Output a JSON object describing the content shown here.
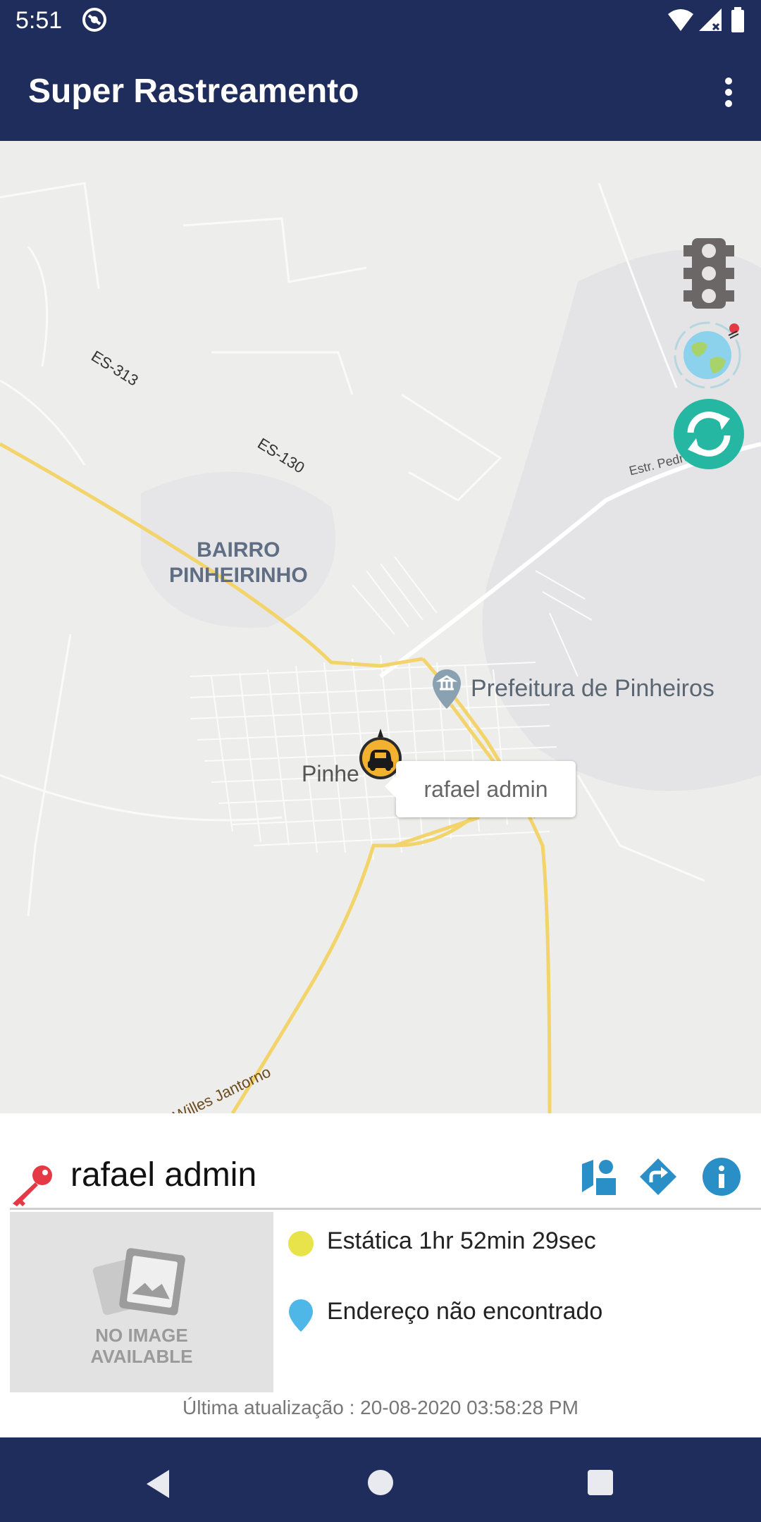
{
  "status_bar": {
    "time": "5:51"
  },
  "app_bar": {
    "title": "Super Rastreamento"
  },
  "map": {
    "labels": {
      "bairro_line1": "BAIRRO",
      "bairro_line2": "PINHEIRINHO",
      "prefeitura": "Prefeitura de Pinheiros",
      "city": "Pinhe",
      "road_es313": "ES-313",
      "road_es130": "ES-130",
      "road_estr": "Estr. Pedro",
      "road_willes": "Willes Jantorno"
    },
    "tooltip": "rafael admin"
  },
  "vehicle_panel": {
    "name": "rafael admin",
    "image_placeholder": {
      "line1": "NO IMAGE",
      "line2": "AVAILABLE"
    },
    "status": {
      "text": "Estática 1hr 52min 29sec",
      "color": "#e8e34b"
    },
    "address": {
      "text": "Endereço não encontrado",
      "color": "#4fb6e8"
    },
    "last_update": "Última atualização : 20-08-2020 03:58:28 PM"
  },
  "colors": {
    "primary": "#1f2d5c",
    "accent_teal": "#26b7a3",
    "action_blue": "#2a8fc7",
    "key_red": "#e53945"
  }
}
